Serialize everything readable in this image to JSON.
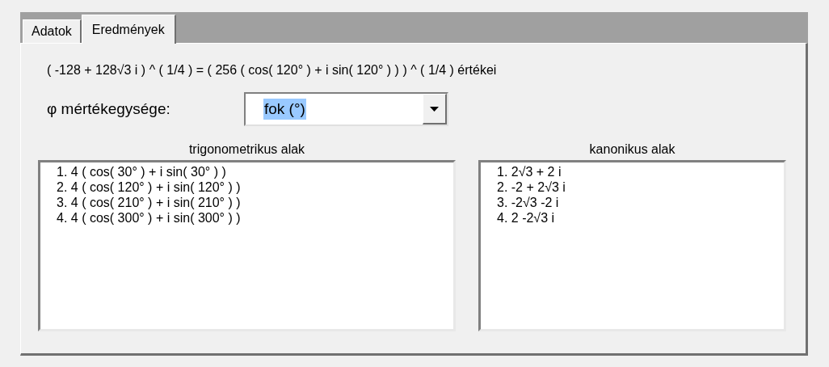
{
  "tabs": [
    {
      "label": "Adatok",
      "selected": false
    },
    {
      "label": "Eredmények",
      "selected": true
    }
  ],
  "formula": "( -128 + 128√3 i ) ^ ( 1/4 ) = ( 256 ( cos( 120° ) + i sin( 120° ) ) ) ^ ( 1/4 ) értékei",
  "unit": {
    "label": "φ mértékegysége:",
    "value": "fok (°)",
    "text_selected": true
  },
  "lists": [
    {
      "heading": "trigonometrikus alak",
      "items": [
        "1. 4 ( cos( 30° ) + i sin( 30° ) )",
        "2. 4 ( cos( 120° ) + i sin( 120° ) )",
        "3. 4 ( cos( 210° ) + i sin( 210° ) )",
        "4. 4 ( cos( 300° ) + i sin( 300° ) )"
      ]
    },
    {
      "heading": "kanonikus alak",
      "items": [
        "1. 2√3 + 2 i",
        "2. -2 + 2√3 i",
        "3. -2√3 -2 i",
        "4. 2 -2√3 i"
      ]
    }
  ]
}
